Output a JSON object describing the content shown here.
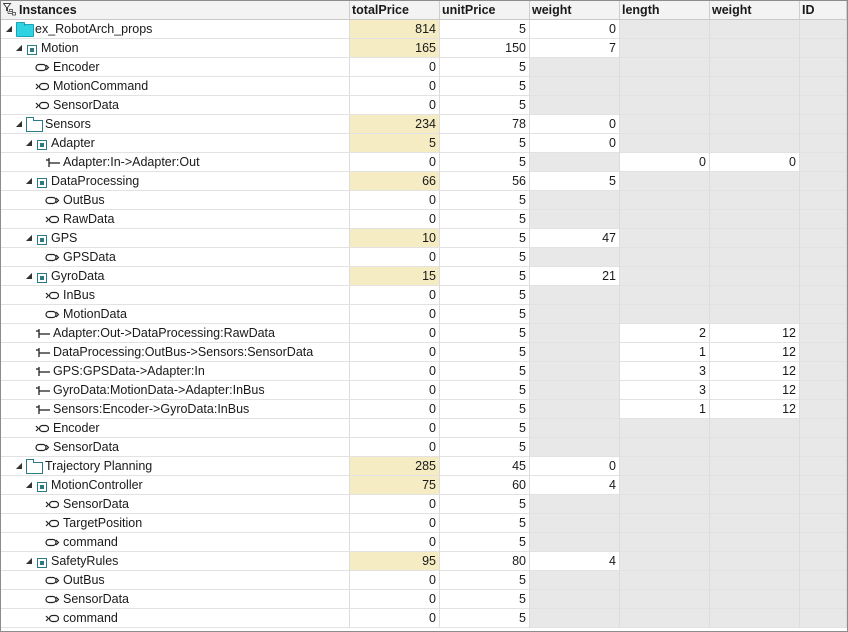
{
  "columns": [
    "Instances",
    "totalPrice",
    "unitPrice",
    "weight",
    "length",
    "weight",
    "ID"
  ],
  "rows": [
    {
      "label": "ex_RobotArch_props",
      "level": 0,
      "icon": "folder-cyan-icon",
      "expander": "open",
      "cells": [
        "814",
        "5",
        "0",
        "",
        "",
        ""
      ],
      "styles": [
        "y",
        "w",
        "w",
        "g",
        "g",
        "g"
      ]
    },
    {
      "label": "Motion",
      "level": 1,
      "icon": "component-icon",
      "expander": "open",
      "cells": [
        "165",
        "150",
        "7",
        "",
        "",
        ""
      ],
      "styles": [
        "y",
        "w",
        "w",
        "g",
        "g",
        "g"
      ]
    },
    {
      "label": "Encoder",
      "level": 2,
      "icon": "port-out-icon",
      "expander": "none",
      "cells": [
        "0",
        "5",
        "",
        "",
        "",
        ""
      ],
      "styles": [
        "w",
        "w",
        "g",
        "g",
        "g",
        "g"
      ]
    },
    {
      "label": "MotionCommand",
      "level": 2,
      "icon": "port-in-icon",
      "expander": "none",
      "cells": [
        "0",
        "5",
        "",
        "",
        "",
        ""
      ],
      "styles": [
        "w",
        "w",
        "g",
        "g",
        "g",
        "g"
      ]
    },
    {
      "label": "SensorData",
      "level": 2,
      "icon": "port-in-icon",
      "expander": "none",
      "cells": [
        "0",
        "5",
        "",
        "",
        "",
        ""
      ],
      "styles": [
        "w",
        "w",
        "g",
        "g",
        "g",
        "g"
      ]
    },
    {
      "label": "Sensors",
      "level": 1,
      "icon": "folder-icon",
      "expander": "open",
      "cells": [
        "234",
        "78",
        "0",
        "",
        "",
        ""
      ],
      "styles": [
        "y",
        "w",
        "w",
        "g",
        "g",
        "g"
      ]
    },
    {
      "label": "Adapter",
      "level": 2,
      "icon": "component-icon",
      "expander": "open",
      "cells": [
        "5",
        "5",
        "0",
        "",
        "",
        ""
      ],
      "styles": [
        "y",
        "w",
        "w",
        "g",
        "g",
        "g"
      ]
    },
    {
      "label": "Adapter:In->Adapter:Out",
      "level": 3,
      "icon": "connector-icon",
      "expander": "none",
      "cells": [
        "0",
        "5",
        "",
        "0",
        "0",
        ""
      ],
      "styles": [
        "w",
        "w",
        "g",
        "w",
        "w",
        "g"
      ]
    },
    {
      "label": "DataProcessing",
      "level": 2,
      "icon": "component-icon",
      "expander": "open",
      "cells": [
        "66",
        "56",
        "5",
        "",
        "",
        ""
      ],
      "styles": [
        "y",
        "w",
        "w",
        "g",
        "g",
        "g"
      ]
    },
    {
      "label": "OutBus",
      "level": 3,
      "icon": "port-out-icon",
      "expander": "none",
      "cells": [
        "0",
        "5",
        "",
        "",
        "",
        ""
      ],
      "styles": [
        "w",
        "w",
        "g",
        "g",
        "g",
        "g"
      ]
    },
    {
      "label": "RawData",
      "level": 3,
      "icon": "port-in-icon",
      "expander": "none",
      "cells": [
        "0",
        "5",
        "",
        "",
        "",
        ""
      ],
      "styles": [
        "w",
        "w",
        "g",
        "g",
        "g",
        "g"
      ]
    },
    {
      "label": "GPS",
      "level": 2,
      "icon": "component-icon",
      "expander": "open",
      "cells": [
        "10",
        "5",
        "47",
        "",
        "",
        ""
      ],
      "styles": [
        "y",
        "w",
        "w",
        "g",
        "g",
        "g"
      ]
    },
    {
      "label": "GPSData",
      "level": 3,
      "icon": "port-out-icon",
      "expander": "none",
      "cells": [
        "0",
        "5",
        "",
        "",
        "",
        ""
      ],
      "styles": [
        "w",
        "w",
        "g",
        "g",
        "g",
        "g"
      ]
    },
    {
      "label": "GyroData",
      "level": 2,
      "icon": "component-icon",
      "expander": "open",
      "cells": [
        "15",
        "5",
        "21",
        "",
        "",
        ""
      ],
      "styles": [
        "y",
        "w",
        "w",
        "g",
        "g",
        "g"
      ]
    },
    {
      "label": "InBus",
      "level": 3,
      "icon": "port-in-icon",
      "expander": "none",
      "cells": [
        "0",
        "5",
        "",
        "",
        "",
        ""
      ],
      "styles": [
        "w",
        "w",
        "g",
        "g",
        "g",
        "g"
      ]
    },
    {
      "label": "MotionData",
      "level": 3,
      "icon": "port-out-icon",
      "expander": "none",
      "cells": [
        "0",
        "5",
        "",
        "",
        "",
        ""
      ],
      "styles": [
        "w",
        "w",
        "g",
        "g",
        "g",
        "g"
      ]
    },
    {
      "label": "Adapter:Out->DataProcessing:RawData",
      "level": 2,
      "icon": "connector-icon",
      "expander": "none",
      "cells": [
        "0",
        "5",
        "",
        "2",
        "12",
        ""
      ],
      "styles": [
        "w",
        "w",
        "g",
        "w",
        "w",
        "g"
      ]
    },
    {
      "label": "DataProcessing:OutBus->Sensors:SensorData",
      "level": 2,
      "icon": "connector-icon",
      "expander": "none",
      "cells": [
        "0",
        "5",
        "",
        "1",
        "12",
        ""
      ],
      "styles": [
        "w",
        "w",
        "g",
        "w",
        "w",
        "g"
      ]
    },
    {
      "label": "GPS:GPSData->Adapter:In",
      "level": 2,
      "icon": "connector-icon",
      "expander": "none",
      "cells": [
        "0",
        "5",
        "",
        "3",
        "12",
        ""
      ],
      "styles": [
        "w",
        "w",
        "g",
        "w",
        "w",
        "g"
      ]
    },
    {
      "label": "GyroData:MotionData->Adapter:InBus",
      "level": 2,
      "icon": "connector-icon",
      "expander": "none",
      "cells": [
        "0",
        "5",
        "",
        "3",
        "12",
        ""
      ],
      "styles": [
        "w",
        "w",
        "g",
        "w",
        "w",
        "g"
      ]
    },
    {
      "label": "Sensors:Encoder->GyroData:InBus",
      "level": 2,
      "icon": "connector-icon",
      "expander": "none",
      "cells": [
        "0",
        "5",
        "",
        "1",
        "12",
        ""
      ],
      "styles": [
        "w",
        "w",
        "g",
        "w",
        "w",
        "g"
      ]
    },
    {
      "label": "Encoder",
      "level": 2,
      "icon": "port-in-icon",
      "expander": "none",
      "cells": [
        "0",
        "5",
        "",
        "",
        "",
        ""
      ],
      "styles": [
        "w",
        "w",
        "g",
        "g",
        "g",
        "g"
      ]
    },
    {
      "label": "SensorData",
      "level": 2,
      "icon": "port-out-icon",
      "expander": "none",
      "cells": [
        "0",
        "5",
        "",
        "",
        "",
        ""
      ],
      "styles": [
        "w",
        "w",
        "g",
        "g",
        "g",
        "g"
      ]
    },
    {
      "label": "Trajectory Planning",
      "level": 1,
      "icon": "folder-icon",
      "expander": "open",
      "cells": [
        "285",
        "45",
        "0",
        "",
        "",
        ""
      ],
      "styles": [
        "y",
        "w",
        "w",
        "g",
        "g",
        "g"
      ]
    },
    {
      "label": "MotionController",
      "level": 2,
      "icon": "component-icon",
      "expander": "open",
      "cells": [
        "75",
        "60",
        "4",
        "",
        "",
        ""
      ],
      "styles": [
        "y",
        "w",
        "w",
        "g",
        "g",
        "g"
      ]
    },
    {
      "label": "SensorData",
      "level": 3,
      "icon": "port-in-icon",
      "expander": "none",
      "cells": [
        "0",
        "5",
        "",
        "",
        "",
        ""
      ],
      "styles": [
        "w",
        "w",
        "g",
        "g",
        "g",
        "g"
      ]
    },
    {
      "label": "TargetPosition",
      "level": 3,
      "icon": "port-in-icon",
      "expander": "none",
      "cells": [
        "0",
        "5",
        "",
        "",
        "",
        ""
      ],
      "styles": [
        "w",
        "w",
        "g",
        "g",
        "g",
        "g"
      ]
    },
    {
      "label": "command",
      "level": 3,
      "icon": "port-out-icon",
      "expander": "none",
      "cells": [
        "0",
        "5",
        "",
        "",
        "",
        ""
      ],
      "styles": [
        "w",
        "w",
        "g",
        "g",
        "g",
        "g"
      ]
    },
    {
      "label": "SafetyRules",
      "level": 2,
      "icon": "component-icon",
      "expander": "open",
      "cells": [
        "95",
        "80",
        "4",
        "",
        "",
        ""
      ],
      "styles": [
        "y",
        "w",
        "w",
        "g",
        "g",
        "g"
      ]
    },
    {
      "label": "OutBus",
      "level": 3,
      "icon": "port-out-icon",
      "expander": "none",
      "cells": [
        "0",
        "5",
        "",
        "",
        "",
        ""
      ],
      "styles": [
        "w",
        "w",
        "g",
        "g",
        "g",
        "g"
      ]
    },
    {
      "label": "SensorData",
      "level": 3,
      "icon": "port-out-icon",
      "expander": "none",
      "cells": [
        "0",
        "5",
        "",
        "",
        "",
        ""
      ],
      "styles": [
        "w",
        "w",
        "g",
        "g",
        "g",
        "g"
      ]
    },
    {
      "label": "command",
      "level": 3,
      "icon": "port-in-icon",
      "expander": "none",
      "cells": [
        "0",
        "5",
        "",
        "",
        "",
        ""
      ],
      "styles": [
        "w",
        "w",
        "g",
        "g",
        "g",
        "g"
      ]
    }
  ],
  "header_icon": "filter-hierarchy-icon"
}
